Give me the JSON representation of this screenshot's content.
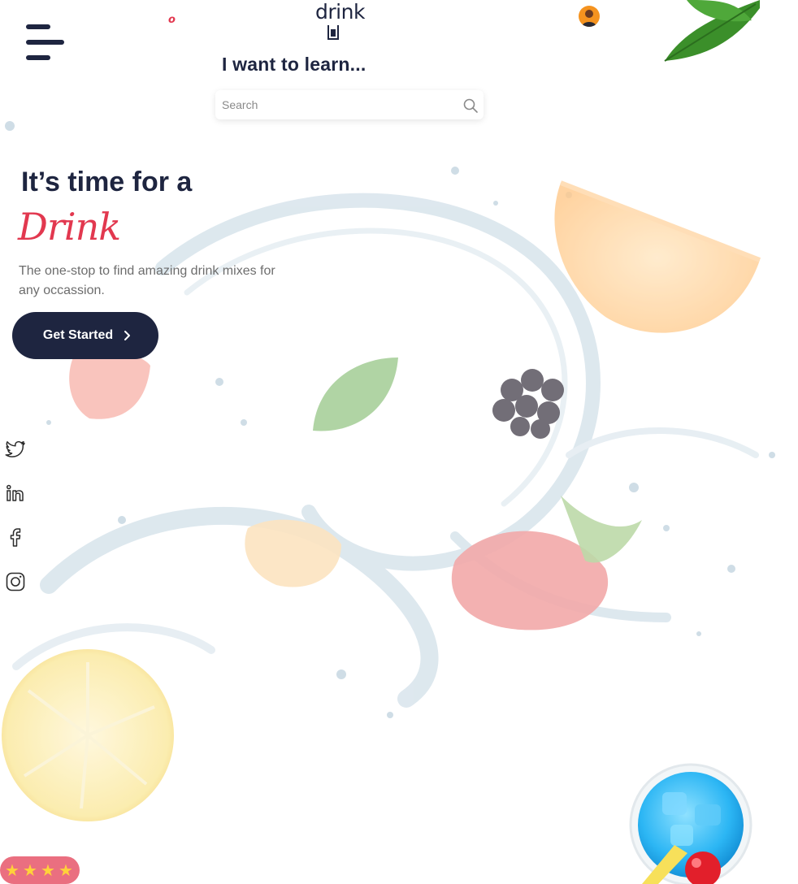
{
  "header": {
    "menu_icon": "hamburger-menu-icon",
    "accent_glyph": "o",
    "logo_text": "drink",
    "avatar_icon": "user-avatar-icon"
  },
  "search": {
    "heading": "I want to learn...",
    "placeholder": "Search",
    "value": "",
    "icon": "search-icon"
  },
  "hero": {
    "headline": "It’s time for a",
    "script_word": "Drink",
    "subtitle": "The one-stop to find amazing drink mixes for any occassion.",
    "cta_label": "Get Started",
    "cta_icon": "chevron-right-icon"
  },
  "social": [
    {
      "name": "twitter",
      "icon": "twitter-icon"
    },
    {
      "name": "linkedin",
      "icon": "linkedin-icon"
    },
    {
      "name": "facebook",
      "icon": "facebook-icon"
    },
    {
      "name": "instagram",
      "icon": "instagram-icon"
    }
  ],
  "rating": {
    "stars": 4,
    "max": 4,
    "icon": "star-icon"
  },
  "colors": {
    "primary": "#1e2540",
    "accent": "#e2384f",
    "text_muted": "#6d6d6d",
    "star": "#ffd23a",
    "avatar_bg": "#f5931f"
  }
}
